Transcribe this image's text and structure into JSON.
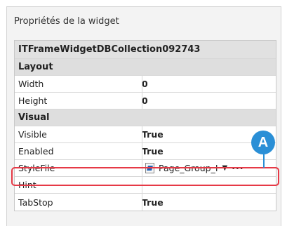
{
  "panel": {
    "title": "Propriétés de la widget"
  },
  "grid": {
    "object_name": "ITFrameWidgetDBCollection092743",
    "sections": {
      "layout": "Layout",
      "visual": "Visual"
    },
    "rows": {
      "width": {
        "name": "Width",
        "value": "0"
      },
      "height": {
        "name": "Height",
        "value": "0"
      },
      "visible": {
        "name": "Visible",
        "value": "True"
      },
      "enabled": {
        "name": "Enabled",
        "value": "True"
      },
      "stylefile": {
        "name": "StyleFile",
        "value": "Page_Group_I",
        "arrow": "▼",
        "more": "···"
      },
      "hint": {
        "name": "Hint",
        "value": ""
      },
      "tabstop": {
        "name": "TabStop",
        "value": "True"
      }
    }
  },
  "callout": {
    "label": "A",
    "color": "#2a8fd6",
    "highlight_color": "#e63946"
  }
}
